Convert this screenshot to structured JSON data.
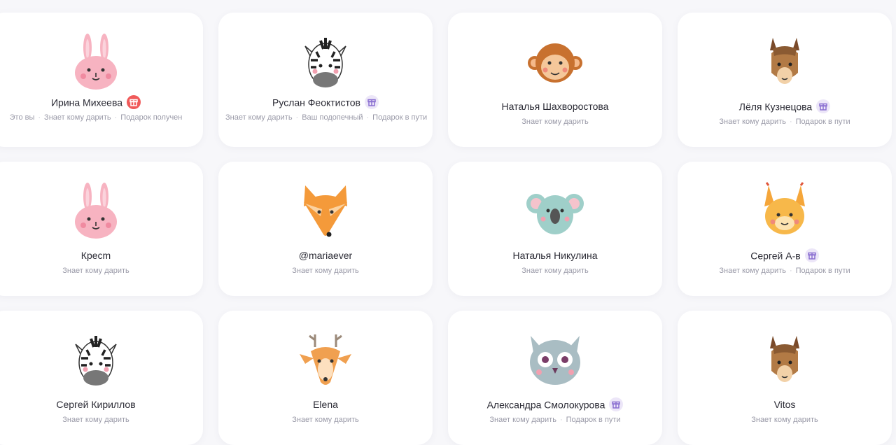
{
  "cards": [
    {
      "name": "Ирина Михеева",
      "badge": "red",
      "animal": "bunny",
      "tags": [
        "Это вы",
        "Знает кому дарить",
        "Подарок получен"
      ]
    },
    {
      "name": "Руслан Феоктистов",
      "badge": "purple",
      "animal": "zebra",
      "tags": [
        "Знает кому дарить",
        "Ваш подопечный",
        "Подарок в пути"
      ]
    },
    {
      "name": "Наталья Шахворостова",
      "badge": "",
      "animal": "monkey",
      "tags": [
        "Знает кому дарить"
      ]
    },
    {
      "name": "Лёля Кузнецова",
      "badge": "purple",
      "animal": "llama",
      "tags": [
        "Знает кому дарить",
        "Подарок в пути"
      ]
    },
    {
      "name": "Кресm",
      "badge": "",
      "animal": "bunny",
      "tags": [
        "Знает кому дарить"
      ]
    },
    {
      "name": "@mariaever",
      "badge": "",
      "animal": "fox",
      "tags": [
        "Знает кому дарить"
      ]
    },
    {
      "name": "Наталья Никулина",
      "badge": "",
      "animal": "koala",
      "tags": [
        "Знает кому дарить"
      ]
    },
    {
      "name": "Сергей А-в",
      "badge": "purple",
      "animal": "squirrel",
      "tags": [
        "Знает кому дарить",
        "Подарок в пути"
      ]
    },
    {
      "name": "Сергей Кириллов",
      "badge": "",
      "animal": "zebra",
      "tags": [
        "Знает кому дарить"
      ]
    },
    {
      "name": "Elena",
      "badge": "",
      "animal": "deer",
      "tags": [
        "Знает кому дарить"
      ]
    },
    {
      "name": "Александра Смолокурова",
      "badge": "purple",
      "animal": "owl",
      "tags": [
        "Знает кому дарить",
        "Подарок в пути"
      ]
    },
    {
      "name": "Vitos",
      "badge": "",
      "animal": "llama",
      "tags": [
        "Знает кому дарить"
      ]
    }
  ],
  "colors": {
    "accent_purple": "#8a6fd1",
    "badge_red": "#f05a5a"
  },
  "icons": {
    "badge": "gift-icon"
  }
}
